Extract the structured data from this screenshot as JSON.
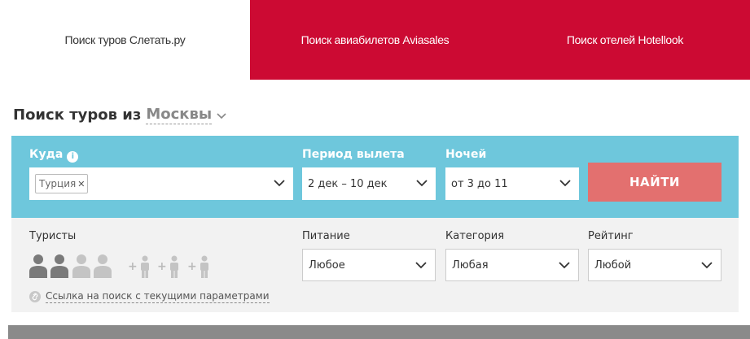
{
  "tabs": {
    "slетать": "Поиск туров Слетать.ру",
    "aviasales": "Поиск авиабилетов Aviasales",
    "hotellook": "Поиск отелей Hotellook"
  },
  "heading": {
    "prefix": "Поиск туров из",
    "city": "Москвы"
  },
  "search": {
    "destination_label": "Куда",
    "destination_tag": "Турция",
    "period_label": "Период вылета",
    "period_value": "2 дек – 10 дек",
    "nights_label": "Ночей",
    "nights_value": "от 3 до 11",
    "submit_label": "НАЙТИ"
  },
  "filters": {
    "tourists_label": "Туристы",
    "adults_selected": 2,
    "adults_total": 4,
    "children_slots": 3,
    "meal_label": "Питание",
    "meal_value": "Любое",
    "category_label": "Категория",
    "category_value": "Любая",
    "rating_label": "Рейтинг",
    "rating_value": "Любой",
    "link_label": "Ссылка на поиск с текущими параметрами"
  },
  "colors": {
    "tab_red": "#cc0a33",
    "blue_panel": "#6ec7dc",
    "search_button": "#e3706f",
    "gray_panel": "#f2f2f2"
  }
}
